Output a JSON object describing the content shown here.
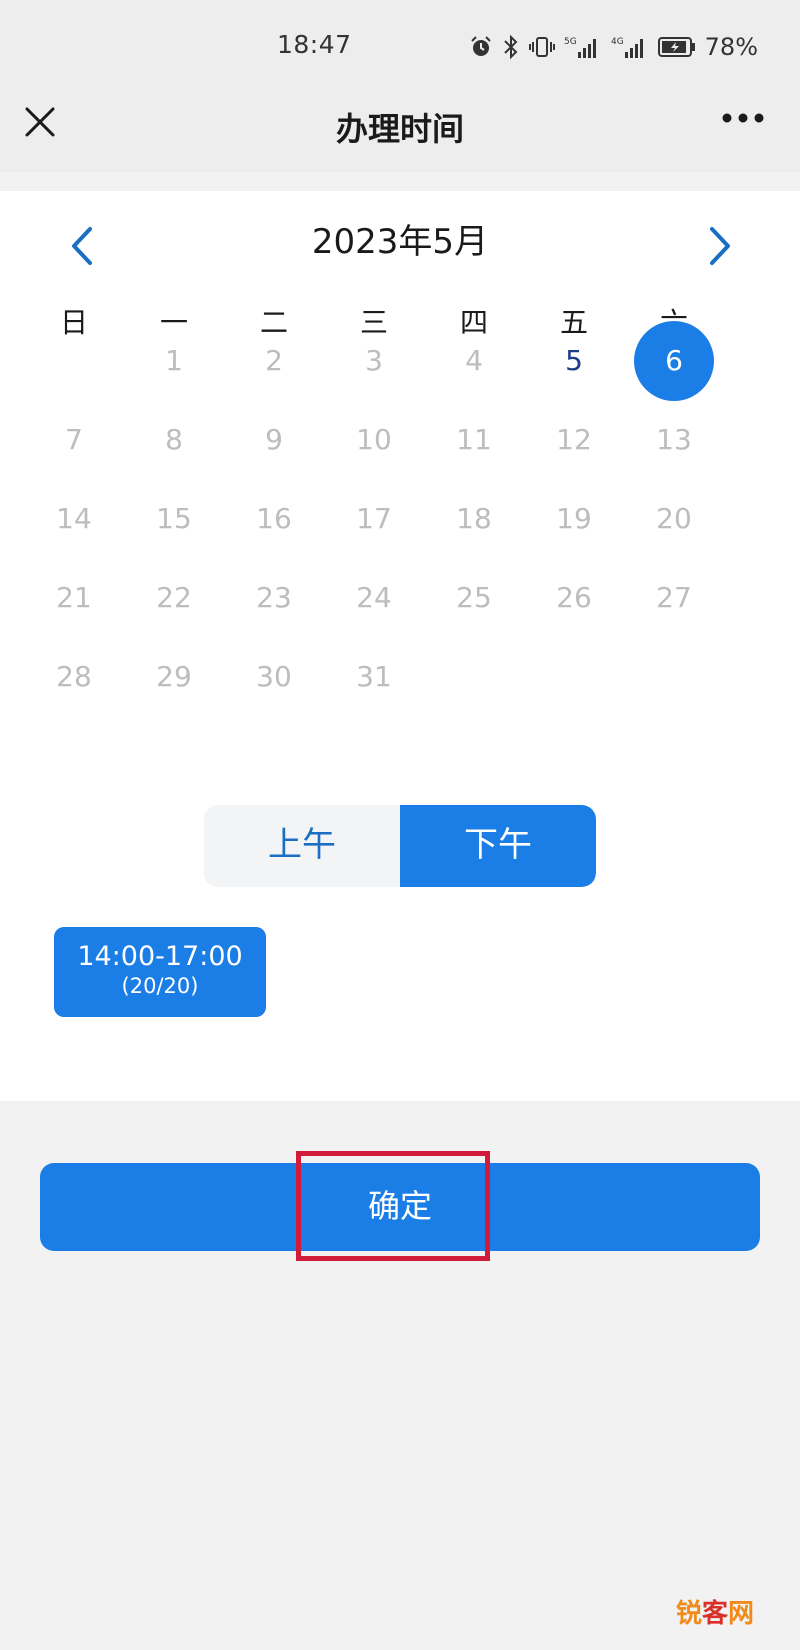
{
  "status_bar": {
    "time": "18:47",
    "battery_percent": "78%",
    "network_labels": [
      "5G",
      "4G"
    ]
  },
  "nav": {
    "title": "办理时间",
    "close_icon": "close-icon",
    "more_icon": "more-icon"
  },
  "calendar": {
    "month_label": "2023年5月",
    "weekdays": [
      "日",
      "一",
      "二",
      "三",
      "四",
      "五",
      "六"
    ],
    "days": [
      "1",
      "2",
      "3",
      "4",
      "5",
      "6",
      "7",
      "8",
      "9",
      "10",
      "11",
      "12",
      "13",
      "14",
      "15",
      "16",
      "17",
      "18",
      "19",
      "20",
      "21",
      "22",
      "23",
      "24",
      "25",
      "26",
      "27",
      "28",
      "29",
      "30",
      "31"
    ],
    "available_days": [
      "5"
    ],
    "selected_day": "6",
    "colors": {
      "selected": "#1a7ee6",
      "available": "#1f3c8a",
      "disabled": "#bdbdbd"
    }
  },
  "period": {
    "am_label": "上午",
    "pm_label": "下午",
    "selected": "下午"
  },
  "slots": [
    {
      "time": "14:00-17:00",
      "capacity": "(20/20)"
    }
  ],
  "confirm_label": "确定",
  "watermark": {
    "text": "锐客网",
    "accent_color": "#f08a1a"
  }
}
